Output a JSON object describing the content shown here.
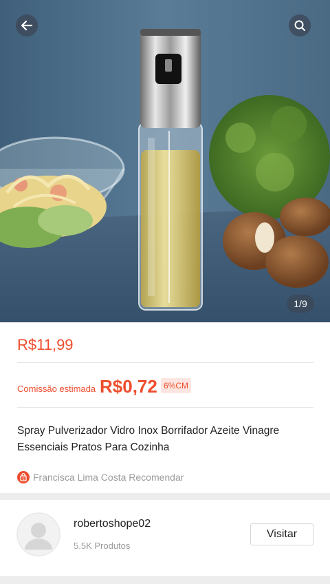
{
  "gallery": {
    "counter": "1/9"
  },
  "product": {
    "price": "R$11,99",
    "commission_label": "Comissão estimada",
    "commission_value": "R$0,72",
    "commission_badge": "6%CM",
    "title": "Spray Pulverizador Vidro Inox Borrifador Azeite Vinagre Essenciais Pratos Para Cozinha",
    "recommender": "Francisca Lima Costa Recomendar"
  },
  "shop": {
    "name": "robertoshope02",
    "products": "5.5K Produtos",
    "visit_label": "Visitar"
  },
  "icons": {
    "back": "arrow-left-icon",
    "search": "search-icon",
    "recommend": "shopee-bag-icon",
    "avatar": "user-avatar-icon"
  },
  "colors": {
    "accent": "#ee4d2d",
    "badge_bg": "#fde6e1",
    "text": "#222222",
    "muted": "#9a9a9a"
  }
}
